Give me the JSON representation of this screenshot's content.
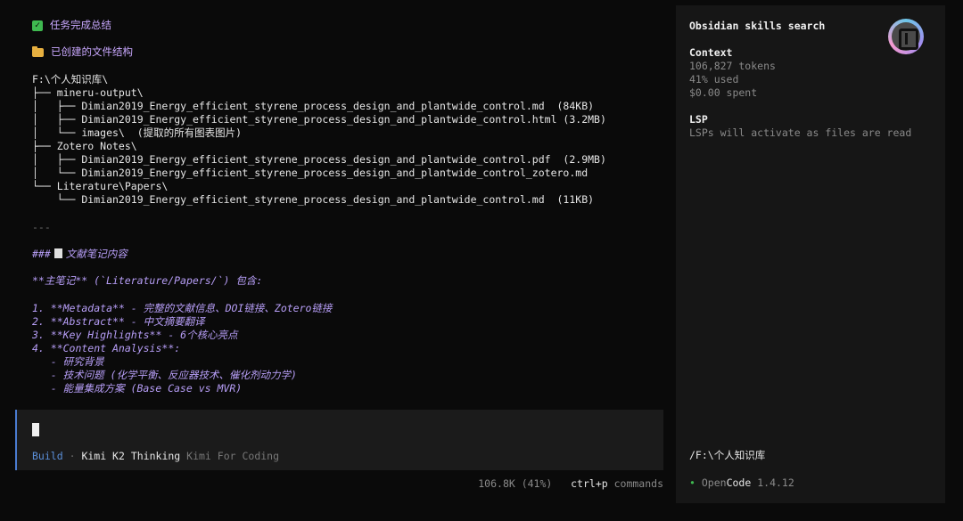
{
  "summary": {
    "task_done": "任务完成总结",
    "created_structure": "已创建的文件结构"
  },
  "tree": [
    "F:\\个人知识库\\",
    "├── mineru-output\\",
    "│   ├── Dimian2019_Energy_efficient_styrene_process_design_and_plantwide_control.md  (84KB)",
    "│   ├── Dimian2019_Energy_efficient_styrene_process_design_and_plantwide_control.html (3.2MB)",
    "│   └── images\\  (提取的所有图表图片)",
    "├── Zotero Notes\\",
    "│   ├── Dimian2019_Energy_efficient_styrene_process_design_and_plantwide_control.pdf  (2.9MB)",
    "│   └── Dimian2019_Energy_efficient_styrene_process_design_and_plantwide_control_zotero.md",
    "└── Literature\\Papers\\",
    "    └── Dimian2019_Energy_efficient_styrene_process_design_and_plantwide_control.md  (11KB)"
  ],
  "markdown": {
    "separator": "---",
    "heading_prefix": "###",
    "heading_text": "文献笔记内容",
    "main_note": "**主笔记** (`Literature/Papers/`) 包含:",
    "items": [
      "1. **Metadata** - 完整的文献信息、DOI链接、Zotero链接",
      "2. **Abstract** - 中文摘要翻译",
      "3. **Key Highlights** - 6个核心亮点",
      "4. **Content Analysis**:",
      "   - 研究背景",
      "   - 技术问题 (化学平衡、反应器技术、催化剂动力学)",
      "   - 能量集成方案 (Base Case vs MVR)"
    ]
  },
  "input": {
    "mode": "Build",
    "separator": "·",
    "model": "Kimi K2 Thinking",
    "provider": "Kimi For Coding"
  },
  "status": {
    "tokens": "106.8K (41%)",
    "shortcut": "ctrl+p",
    "shortcut_label": "commands"
  },
  "sidebar": {
    "title": "Obsidian skills search",
    "context_head": "Context",
    "tokens": "106,827 tokens",
    "used": "41% used",
    "spent": "$0.00 spent",
    "lsp_head": "LSP",
    "lsp_text": "LSPs will activate as files are read",
    "path": "/F:\\个人知识库",
    "app_dot": "•",
    "app_a": "Open",
    "app_b": "Code",
    "version": "1.4.12"
  },
  "colors": {
    "accent": "#5b8fd9",
    "markdown": "#b79ef7",
    "success": "#3fb950",
    "folder": "#e7b040"
  }
}
